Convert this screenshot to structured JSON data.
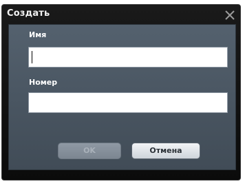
{
  "dialog": {
    "title": "Создать",
    "close_icon": "close-icon"
  },
  "form": {
    "name_label": "Имя",
    "name_value": "",
    "number_label": "Номер",
    "number_value": ""
  },
  "buttons": {
    "ok_label": "OK",
    "cancel_label": "Отмена"
  },
  "colors": {
    "window_bg": "#0b0b0b",
    "panel_bg": "#4a5662",
    "ok_text_disabled": "#a9b1ba",
    "cancel_text": "#2a3036"
  }
}
